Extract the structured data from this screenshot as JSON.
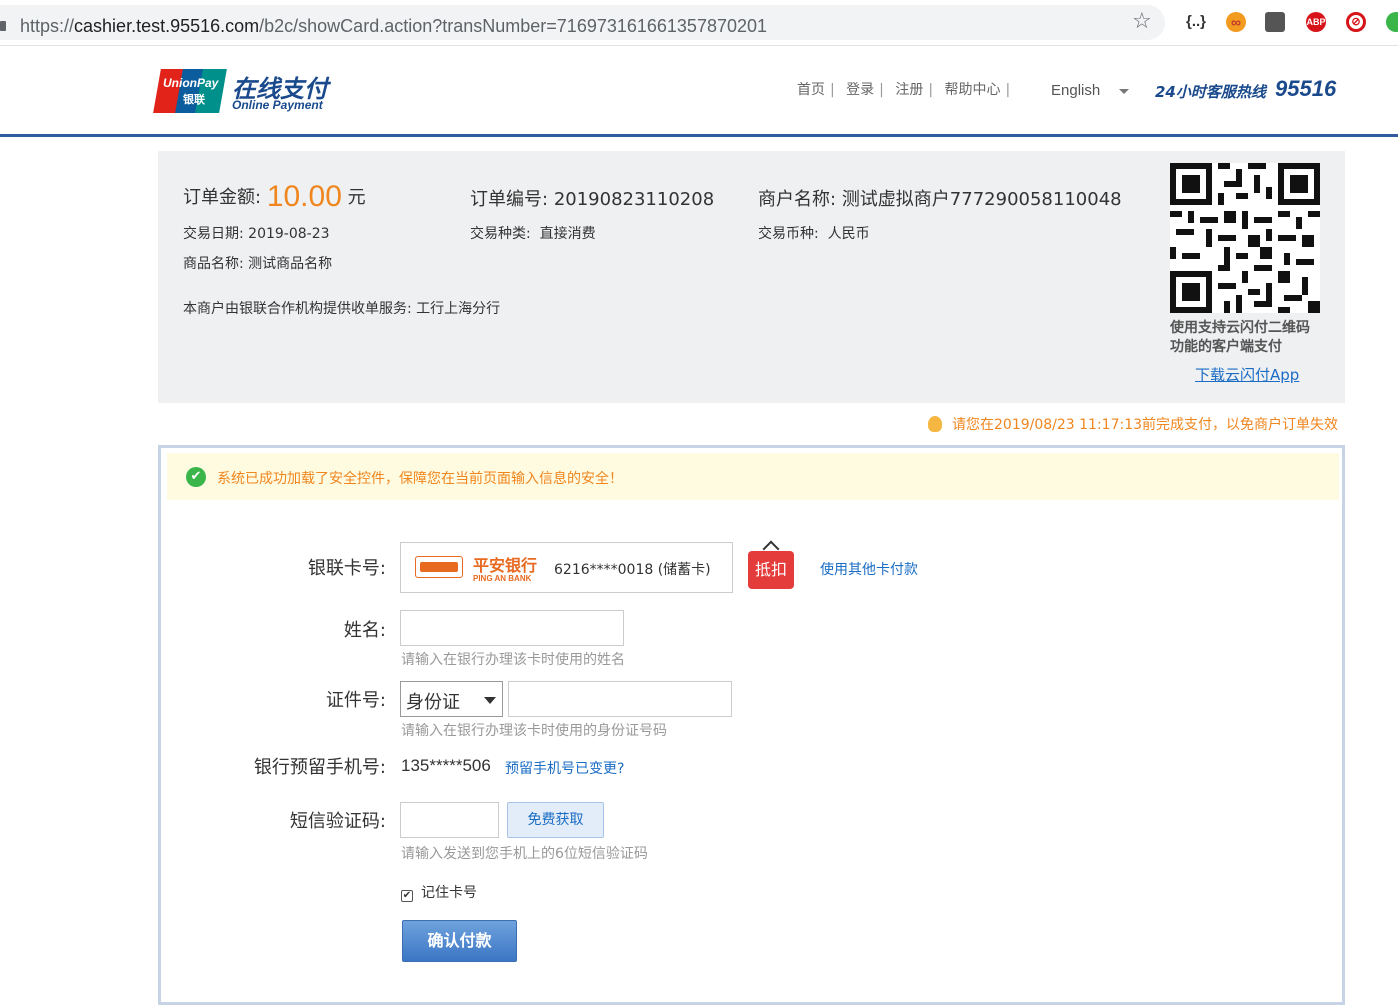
{
  "browser": {
    "url_prefix": "https://",
    "url_host": "cashier.test.95516.com",
    "url_path": "/b2c/showCard.action?transNumber=716973161661357870201",
    "extensions": [
      "json-viewer-icon",
      "infinity-icon",
      "picture-icon",
      "adblock-icon",
      "block-icon",
      "green-extension-icon"
    ],
    "ext_labels": {
      "json": "{..}",
      "inf": "∞",
      "abp": "ABP",
      "blk": "⊘"
    }
  },
  "header": {
    "logo_badge_en": "UnionPay",
    "logo_badge_cn": "银联",
    "logo_cn": "在线支付",
    "logo_en": "Online Payment",
    "nav": [
      "首页",
      "登录",
      "注册",
      "帮助中心"
    ],
    "language": "English",
    "hotline_label": "24小时客服热线",
    "hotline_number": "95516"
  },
  "order": {
    "amount_label": "订单金额:",
    "amount_value": "10.00",
    "amount_unit": "元",
    "order_no_label": "订单编号:",
    "order_no_value": "20190823110208",
    "merchant_label": "商户名称:",
    "merchant_value": "测试虚拟商户777290058110048",
    "date_label": "交易日期:",
    "date_value": "2019-08-23",
    "type_label": "交易种类:",
    "type_value": "直接消费",
    "currency_label": "交易币种:",
    "currency_value": "人民币",
    "product_label": "商品名称:",
    "product_value": "测试商品名称",
    "acquirer_text": "本商户由银联合作机构提供收单服务:",
    "acquirer_value": "工行上海分行",
    "qr_caption_line1": "使用支持云闪付二维码",
    "qr_caption_line2": "功能的客户端支付",
    "qr_link": "下载云闪付App",
    "deadline": "请您在2019/08/23 11:17:13前完成支付，以免商户订单失效"
  },
  "form": {
    "notice": "系统已成功加载了安全控件，保障您在当前页面输入信息的安全！",
    "card_label": "银联卡号:",
    "bank_name": "平安银行",
    "bank_name_en": "PING AN BANK",
    "card_number": "6216****0018 (储蓄卡)",
    "discount_tag": "抵扣",
    "other_card_link": "使用其他卡付款",
    "name_label": "姓名:",
    "name_value": "",
    "name_hint": "请输入在银行办理该卡时使用的姓名",
    "id_label": "证件号:",
    "id_type": "身份证",
    "id_value": "",
    "id_hint": "请输入在银行办理该卡时使用的身份证号码",
    "phone_label": "银行预留手机号:",
    "phone_value": "135*****506",
    "phone_change_link": "预留手机号已变更?",
    "sms_label": "短信验证码:",
    "sms_value": "",
    "sms_button": "免费获取",
    "sms_hint": "请输入发送到您手机上的6位短信验证码",
    "remember_label": "记住卡号",
    "remember_checked": true,
    "confirm_button": "确认付款"
  }
}
